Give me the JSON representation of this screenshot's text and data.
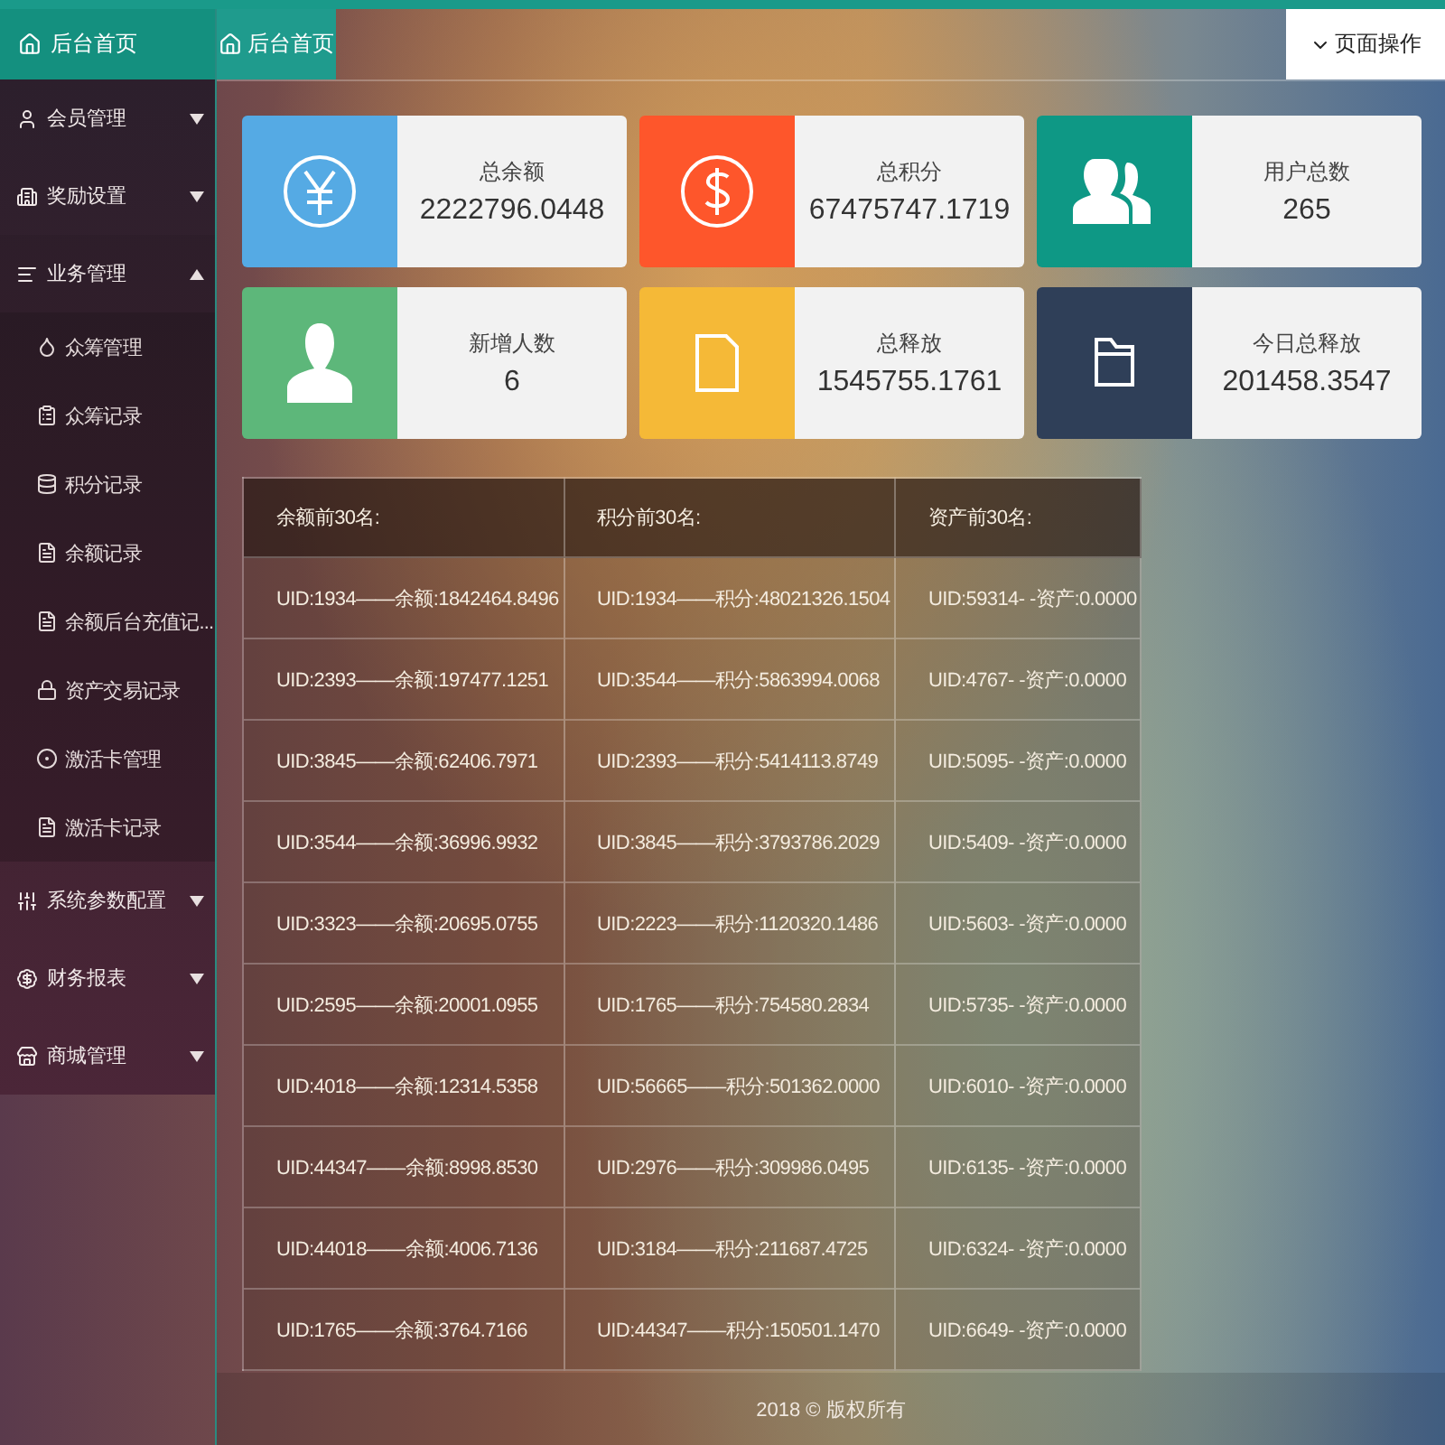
{
  "brand": {
    "label": "后台首页"
  },
  "tabs": [
    {
      "label": "后台首页",
      "selected": true
    }
  ],
  "page_actions": {
    "label": "页面操作"
  },
  "sidebar": {
    "items": [
      {
        "label": "会员管理",
        "expanded": false
      },
      {
        "label": "奖励设置",
        "expanded": false
      },
      {
        "label": "业务管理",
        "expanded": true,
        "children": [
          {
            "label": "众筹管理"
          },
          {
            "label": "众筹记录"
          },
          {
            "label": "积分记录"
          },
          {
            "label": "余额记录"
          },
          {
            "label": "余额后台充值记..."
          },
          {
            "label": "资产交易记录"
          },
          {
            "label": "激活卡管理"
          },
          {
            "label": "激活卡记录"
          }
        ]
      },
      {
        "label": "系统参数配置",
        "expanded": false
      },
      {
        "label": "财务报表",
        "expanded": false
      },
      {
        "label": "商城管理",
        "expanded": false
      }
    ]
  },
  "stats": [
    {
      "label": "总余额",
      "value": "2222796.0448",
      "color": "#55aae4"
    },
    {
      "label": "总积分",
      "value": "67475747.1719",
      "color": "#fe562b"
    },
    {
      "label": "用户总数",
      "value": "265",
      "color": "#0e9885"
    },
    {
      "label": "新增人数",
      "value": "6",
      "color": "#5db77a"
    },
    {
      "label": "总释放",
      "value": "1545755.1761",
      "color": "#f5b937"
    },
    {
      "label": "今日总释放",
      "value": "201458.3547",
      "color": "#2f3f58"
    }
  ],
  "table": {
    "columns": [
      "余额前30名:",
      "积分前30名:",
      "资产前30名:"
    ],
    "rows": [
      [
        "UID:1934——余额:1842464.8496",
        "UID:1934——积分:48021326.1504",
        "UID:59314- -资产:0.0000"
      ],
      [
        "UID:2393——余额:197477.1251",
        "UID:3544——积分:5863994.0068",
        "UID:4767- -资产:0.0000"
      ],
      [
        "UID:3845——余额:62406.7971",
        "UID:2393——积分:5414113.8749",
        "UID:5095- -资产:0.0000"
      ],
      [
        "UID:3544——余额:36996.9932",
        "UID:3845——积分:3793786.2029",
        "UID:5409- -资产:0.0000"
      ],
      [
        "UID:3323——余额:20695.0755",
        "UID:2223——积分:1120320.1486",
        "UID:5603- -资产:0.0000"
      ],
      [
        "UID:2595——余额:20001.0955",
        "UID:1765——积分:754580.2834",
        "UID:5735- -资产:0.0000"
      ],
      [
        "UID:4018——余额:12314.5358",
        "UID:56665——积分:501362.0000",
        "UID:6010- -资产:0.0000"
      ],
      [
        "UID:44347——余额:8998.8530",
        "UID:2976——积分:309986.0495",
        "UID:6135- -资产:0.0000"
      ],
      [
        "UID:44018——余额:4006.7136",
        "UID:3184——积分:211687.4725",
        "UID:6324- -资产:0.0000"
      ],
      [
        "UID:1765——余额:3764.7166",
        "UID:44347——积分:150501.1470",
        "UID:6649- -资产:0.0000"
      ]
    ]
  },
  "footer": {
    "text": "2018 © 版权所有"
  }
}
